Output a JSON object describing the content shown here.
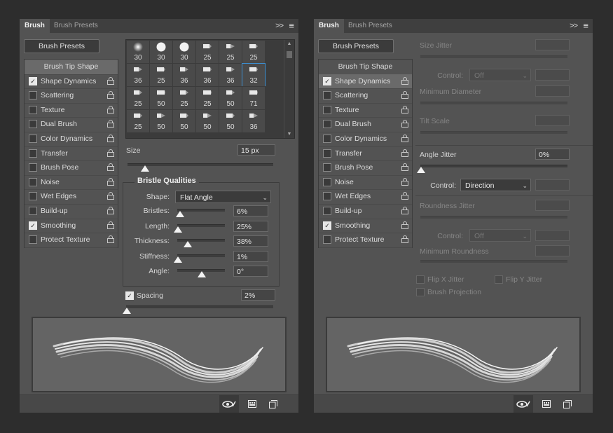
{
  "panel_left": {
    "tabs": [
      "Brush",
      "Brush Presets"
    ],
    "collapse_glyph": ">>",
    "menu_glyph": "≡",
    "presets_button": "Brush Presets",
    "sidebar": [
      {
        "label": "Brush Tip Shape",
        "checkbox": null
      },
      {
        "label": "Shape Dynamics",
        "checkbox": true
      },
      {
        "label": "Scattering",
        "checkbox": false
      },
      {
        "label": "Texture",
        "checkbox": false
      },
      {
        "label": "Dual Brush",
        "checkbox": false
      },
      {
        "label": "Color Dynamics",
        "checkbox": false
      },
      {
        "label": "Transfer",
        "checkbox": false
      },
      {
        "label": "Brush Pose",
        "checkbox": false
      },
      {
        "label": "Noise",
        "checkbox": false
      },
      {
        "label": "Wet Edges",
        "checkbox": false
      },
      {
        "label": "Build-up",
        "checkbox": false
      },
      {
        "label": "Smoothing",
        "checkbox": true
      },
      {
        "label": "Protect Texture",
        "checkbox": false
      }
    ],
    "selected_item": "Brush Tip Shape",
    "brush_grid": [
      [
        "30",
        "30",
        "30",
        "25",
        "25",
        "25"
      ],
      [
        "36",
        "25",
        "36",
        "36",
        "36",
        "32"
      ],
      [
        "25",
        "50",
        "25",
        "25",
        "50",
        "71"
      ],
      [
        "25",
        "50",
        "50",
        "50",
        "50",
        "36"
      ]
    ],
    "size": {
      "label": "Size",
      "value": "15 px",
      "fraction": 0.12
    },
    "bristle": {
      "title": "Bristle Qualities",
      "shape_label": "Shape:",
      "shape_value": "Flat Angle",
      "rows": [
        {
          "label": "Bristles:",
          "value": "6%",
          "fraction": 0.05
        },
        {
          "label": "Length:",
          "value": "25%",
          "fraction": 0.0
        },
        {
          "label": "Thickness:",
          "value": "38%",
          "fraction": 0.2
        },
        {
          "label": "Stiffness:",
          "value": "1%",
          "fraction": 0.0
        },
        {
          "label": "Angle:",
          "value": "0°",
          "fraction": 0.5
        }
      ]
    },
    "spacing": {
      "label": "Spacing",
      "value": "2%",
      "checked": true,
      "fraction": 0.0
    }
  },
  "panel_right": {
    "tabs": [
      "Brush",
      "Brush Presets"
    ],
    "collapse_glyph": ">>",
    "menu_glyph": "≡",
    "presets_button": "Brush Presets",
    "selected_item": "Shape Dynamics",
    "size_jitter": "Size Jitter",
    "control_label": "Control:",
    "control_off": "Off",
    "minimum_diameter": "Minimum Diameter",
    "tilt_scale": "Tilt Scale",
    "angle_jitter": {
      "label": "Angle Jitter",
      "value": "0%",
      "fraction": 0.0
    },
    "angle_control": {
      "label": "Control:",
      "value": "Direction"
    },
    "roundness_jitter": "Roundness Jitter",
    "minimum_roundness": "Minimum Roundness",
    "flip_x": "Flip X Jitter",
    "flip_y": "Flip Y Jitter",
    "brush_projection": "Brush Projection"
  },
  "icons": {
    "eye": "eye-icon",
    "grid": "brush-panel-icon",
    "new": "new-preset-icon"
  },
  "colors": {
    "panel": "#535353",
    "background": "#2d2d2d",
    "selection": "#3b8fd1"
  }
}
